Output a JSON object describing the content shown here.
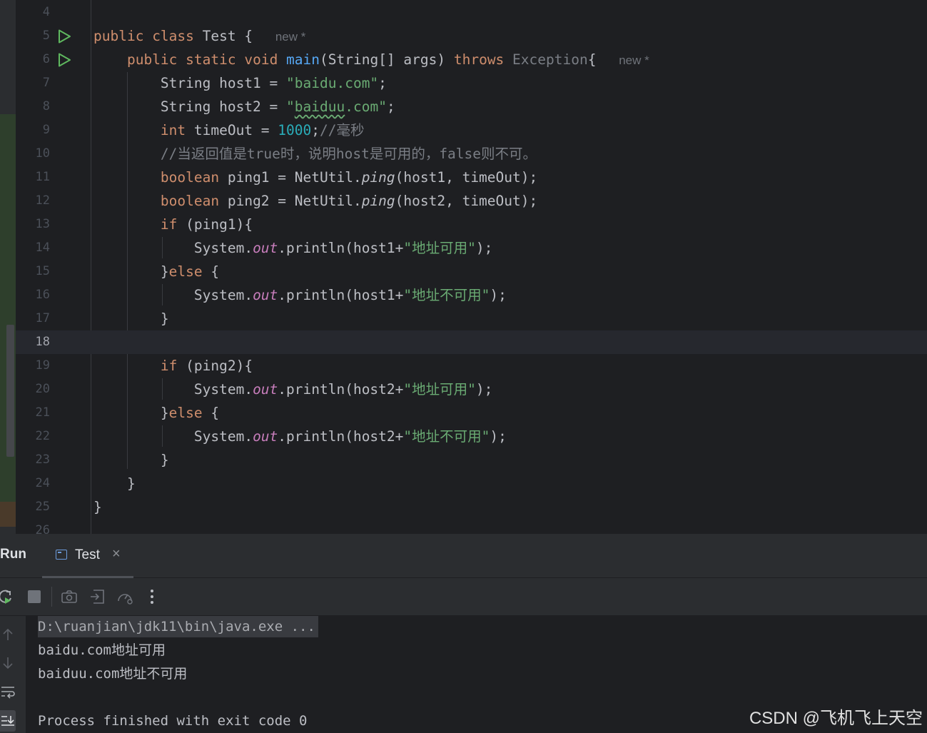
{
  "editor": {
    "lines": [
      {
        "n": "4"
      },
      {
        "n": "5",
        "run": true,
        "code": [
          {
            "t": "public ",
            "c": "kw"
          },
          {
            "t": "class ",
            "c": "kw"
          },
          {
            "t": "Test { "
          },
          {
            "t": "new *",
            "c": "hint"
          }
        ]
      },
      {
        "n": "6",
        "run": true,
        "code": [
          {
            "t": "    "
          },
          {
            "t": "public ",
            "c": "kw"
          },
          {
            "t": "static ",
            "c": "kw"
          },
          {
            "t": "void ",
            "c": "kw"
          },
          {
            "t": "main",
            "c": "fn"
          },
          {
            "t": "(String[] args) "
          },
          {
            "t": "throws ",
            "c": "kw"
          },
          {
            "t": "Exception",
            "c": "cmt"
          },
          {
            "t": "{ "
          },
          {
            "t": "new *",
            "c": "hint"
          }
        ]
      },
      {
        "n": "7",
        "code": [
          {
            "t": "        String host1 = "
          },
          {
            "t": "\"baidu.com\"",
            "c": "str"
          },
          {
            "t": ";"
          }
        ]
      },
      {
        "n": "8",
        "code": [
          {
            "t": "        String host2 = "
          },
          {
            "t": "\"",
            "c": "str"
          },
          {
            "t": "baiduu",
            "c": "str typo"
          },
          {
            "t": ".com\"",
            "c": "str"
          },
          {
            "t": ";"
          }
        ]
      },
      {
        "n": "9",
        "code": [
          {
            "t": "        "
          },
          {
            "t": "int ",
            "c": "kw"
          },
          {
            "t": "timeOut = "
          },
          {
            "t": "1000",
            "c": "num"
          },
          {
            "t": ";"
          },
          {
            "t": "//毫秒",
            "c": "cmt"
          }
        ]
      },
      {
        "n": "10",
        "code": [
          {
            "t": "        "
          },
          {
            "t": "//当返回值是true时，说明host是可用的，false则不可。",
            "c": "cmt"
          }
        ]
      },
      {
        "n": "11",
        "code": [
          {
            "t": "        "
          },
          {
            "t": "boolean ",
            "c": "kw"
          },
          {
            "t": "ping1 = NetUtil."
          },
          {
            "t": "ping",
            "c": "stat"
          },
          {
            "t": "(host1, timeOut);"
          }
        ]
      },
      {
        "n": "12",
        "code": [
          {
            "t": "        "
          },
          {
            "t": "boolean ",
            "c": "kw"
          },
          {
            "t": "ping2 = NetUtil."
          },
          {
            "t": "ping",
            "c": "stat"
          },
          {
            "t": "(host2, timeOut);"
          }
        ]
      },
      {
        "n": "13",
        "code": [
          {
            "t": "        "
          },
          {
            "t": "if ",
            "c": "kw"
          },
          {
            "t": "(ping1){"
          }
        ]
      },
      {
        "n": "14",
        "code": [
          {
            "t": "            System."
          },
          {
            "t": "out",
            "c": "field"
          },
          {
            "t": ".println(host1+"
          },
          {
            "t": "\"地址可用\"",
            "c": "str"
          },
          {
            "t": ");"
          }
        ]
      },
      {
        "n": "15",
        "code": [
          {
            "t": "        }"
          },
          {
            "t": "else ",
            "c": "kw"
          },
          {
            "t": "{"
          }
        ]
      },
      {
        "n": "16",
        "code": [
          {
            "t": "            System."
          },
          {
            "t": "out",
            "c": "field"
          },
          {
            "t": ".println(host1+"
          },
          {
            "t": "\"地址不可用\"",
            "c": "str"
          },
          {
            "t": ");"
          }
        ]
      },
      {
        "n": "17",
        "code": [
          {
            "t": "        }"
          }
        ]
      },
      {
        "n": "18",
        "current": true
      },
      {
        "n": "19",
        "code": [
          {
            "t": "        "
          },
          {
            "t": "if ",
            "c": "kw"
          },
          {
            "t": "(ping2){"
          }
        ]
      },
      {
        "n": "20",
        "code": [
          {
            "t": "            System."
          },
          {
            "t": "out",
            "c": "field"
          },
          {
            "t": ".println(host2+"
          },
          {
            "t": "\"地址可用\"",
            "c": "str"
          },
          {
            "t": ");"
          }
        ]
      },
      {
        "n": "21",
        "code": [
          {
            "t": "        }"
          },
          {
            "t": "else ",
            "c": "kw"
          },
          {
            "t": "{"
          }
        ]
      },
      {
        "n": "22",
        "code": [
          {
            "t": "            System."
          },
          {
            "t": "out",
            "c": "field"
          },
          {
            "t": ".println(host2+"
          },
          {
            "t": "\"地址不可用\"",
            "c": "str"
          },
          {
            "t": ");"
          }
        ]
      },
      {
        "n": "23",
        "code": [
          {
            "t": "        }"
          }
        ]
      },
      {
        "n": "24",
        "code": [
          {
            "t": "    }"
          }
        ]
      },
      {
        "n": "25",
        "code": [
          {
            "t": "}"
          }
        ]
      },
      {
        "n": "26"
      }
    ]
  },
  "run_panel": {
    "title": "Run",
    "tab_label": "Test",
    "tab_close": "×",
    "toolbar_icons": [
      "rerun-icon",
      "stop-icon",
      "camera-icon",
      "exit-icon",
      "profiler-icon",
      "more-icon"
    ],
    "side_icons": [
      "arrow-up-icon",
      "arrow-down-icon",
      "soft-wrap-icon",
      "scroll-to-end-icon"
    ]
  },
  "console": {
    "command": "D:\\ruanjian\\jdk11\\bin\\java.exe ...",
    "output1_prefix": "baidu.com",
    "output1_cjk": "地址可用",
    "output2_prefix": "baiduu.com",
    "output2_cjk": "地址不可用",
    "exit": "Process finished with exit code 0"
  },
  "watermark": "CSDN @飞机飞上天空",
  "colors": {
    "keyword": "#cf8e6d",
    "function": "#56a8f5",
    "string": "#6aab73",
    "number": "#2aacb8",
    "comment": "#7a7e85",
    "field": "#c77dbb",
    "run_icon": "#5fb85f"
  }
}
